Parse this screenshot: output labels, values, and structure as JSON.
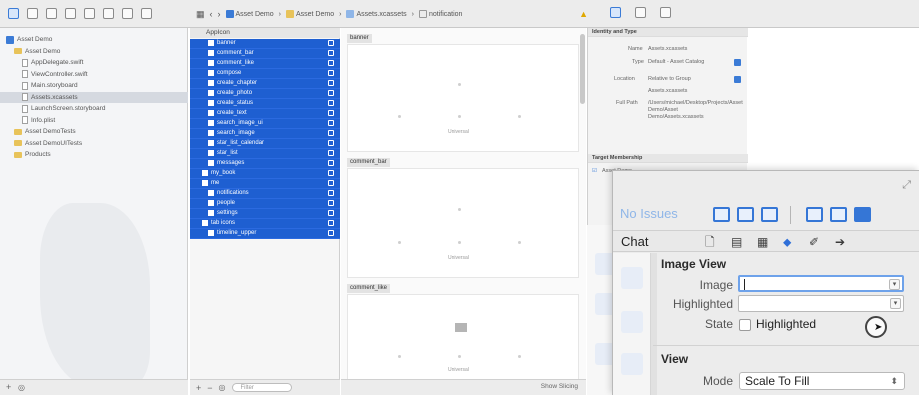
{
  "toolbar": {
    "breadcrumbs": [
      "Asset Demo",
      "Asset Demo",
      "Assets.xcassets",
      "notification"
    ]
  },
  "navigator": {
    "items": [
      {
        "label": "Asset Demo",
        "kind": "project",
        "indent": 0
      },
      {
        "label": "Asset Demo",
        "kind": "folder",
        "indent": 1
      },
      {
        "label": "AppDelegate.swift",
        "kind": "file",
        "indent": 2
      },
      {
        "label": "ViewController.swift",
        "kind": "file",
        "indent": 2
      },
      {
        "label": "Main.storyboard",
        "kind": "file",
        "indent": 2
      },
      {
        "label": "Assets.xcassets",
        "kind": "file",
        "indent": 2,
        "selected": true
      },
      {
        "label": "LaunchScreen.storyboard",
        "kind": "file",
        "indent": 2
      },
      {
        "label": "Info.plist",
        "kind": "file",
        "indent": 2
      },
      {
        "label": "Asset DemoTests",
        "kind": "folder",
        "indent": 1
      },
      {
        "label": "Asset DemoUITests",
        "kind": "folder",
        "indent": 1
      },
      {
        "label": "Products",
        "kind": "folder",
        "indent": 1
      }
    ]
  },
  "outline": {
    "header": "AppIcon",
    "rows": [
      "banner",
      "comment_bar",
      "comment_like",
      "compose",
      "create_chapter",
      "create_photo",
      "create_status",
      "create_text",
      "search_image_ui",
      "search_image",
      "star_list_calendar",
      "star_list",
      "messages",
      "my_book",
      "me",
      "notifications",
      "people",
      "settings",
      "tab icons",
      "timeline_upper"
    ],
    "filter_placeholder": "Filter"
  },
  "canvas": {
    "scenes": [
      {
        "label": "banner",
        "caption": "Universal"
      },
      {
        "label": "comment_bar",
        "caption": "Universal"
      },
      {
        "label": "comment_like",
        "caption": "Universal"
      }
    ],
    "show_slicing": "Show Slicing"
  },
  "inspector_bg": {
    "identity_title": "Identity and Type",
    "name_label": "Name",
    "name_value": "Assets.xcassets",
    "type_label": "Type",
    "type_value": "Default - Asset Catalog",
    "location_label": "Location",
    "location_value": "Relative to Group",
    "file_value": "Assets.xcassets",
    "fullpath_label": "Full Path",
    "fullpath_value": "/Users/michael/Desktop/Projects/Asset Demo/Asset Demo/Assets.xcassets",
    "target_title": "Target Membership",
    "target_value": "Asset Demo"
  },
  "zoom_panel": {
    "no_issues": "No Issues",
    "chat": "Chat",
    "section_image_view": "Image View",
    "image_label": "Image",
    "image_value": "",
    "highlighted_label": "Highlighted",
    "highlighted_value": "",
    "state_label": "State",
    "state_checkbox_label": "Highlighted",
    "section_view": "View",
    "mode_label": "Mode",
    "mode_value": "Scale To Fill",
    "accent_color": "#3576d6"
  }
}
